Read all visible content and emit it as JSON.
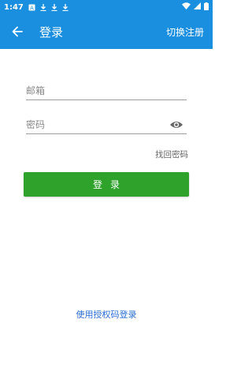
{
  "status_bar": {
    "time": "1:47",
    "icons": [
      "notification-a-icon",
      "download-icon",
      "download-icon",
      "download-icon",
      "wifi-icon",
      "signal-icon",
      "battery-icon"
    ]
  },
  "app_bar": {
    "title": "登录",
    "switch_label": "切换注册",
    "background_color": "#1a8fe0"
  },
  "form": {
    "email_placeholder": "邮箱",
    "email_value": "",
    "password_placeholder": "密码",
    "password_value": "",
    "forgot_password_label": "找回密码",
    "login_button_label": "登录",
    "login_button_color": "#2ea22b"
  },
  "footer": {
    "auth_code_login_label": "使用授权码登录",
    "link_color": "#2a6fd6"
  }
}
